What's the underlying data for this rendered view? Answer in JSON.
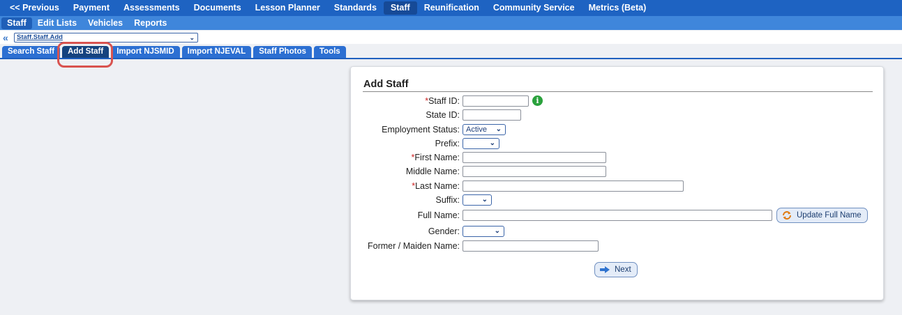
{
  "nav_top": {
    "items": [
      "<< Previous",
      "Payment",
      "Assessments",
      "Documents",
      "Lesson Planner",
      "Standards",
      "Staff",
      "Reunification",
      "Community Service",
      "Metrics (Beta)"
    ],
    "active_index": 6
  },
  "nav_sub": {
    "items": [
      "Staff",
      "Edit Lists",
      "Vehicles",
      "Reports"
    ],
    "active_index": 0
  },
  "path": {
    "back": "«",
    "selected": "Staff.Staff.Add"
  },
  "tabs": {
    "items": [
      "Search Staff",
      "Add Staff",
      "Import NJSMID",
      "Import NJEVAL",
      "Staff Photos",
      "Tools"
    ],
    "active_index": 1
  },
  "form": {
    "title": "Add Staff",
    "required_marker": "*",
    "staff_id_label": "Staff ID:",
    "state_id_label": "State ID:",
    "employment_status_label": "Employment Status:",
    "employment_status_value": "Active",
    "prefix_label": "Prefix:",
    "first_name_label": "First Name:",
    "middle_name_label": "Middle Name:",
    "last_name_label": "Last Name:",
    "suffix_label": "Suffix:",
    "full_name_label": "Full Name:",
    "gender_label": "Gender:",
    "former_name_label": "Former / Maiden Name:",
    "update_full_name_button": "Update Full Name",
    "next_button": "Next",
    "info_glyph": "i"
  },
  "colors": {
    "nav_top_bg": "#1e63c2",
    "nav_sub_bg": "#3f86db",
    "tab_bg": "#2c6fd2",
    "tab_active_bg": "#15437f",
    "highlight_ring": "#d9534f",
    "required": "#cc2222",
    "info_green": "#2aa13c"
  },
  "icons": {
    "refresh": "refresh-icon",
    "arrow": "arrow-right-icon",
    "info": "info-icon",
    "back": "double-chevron-left-icon"
  }
}
